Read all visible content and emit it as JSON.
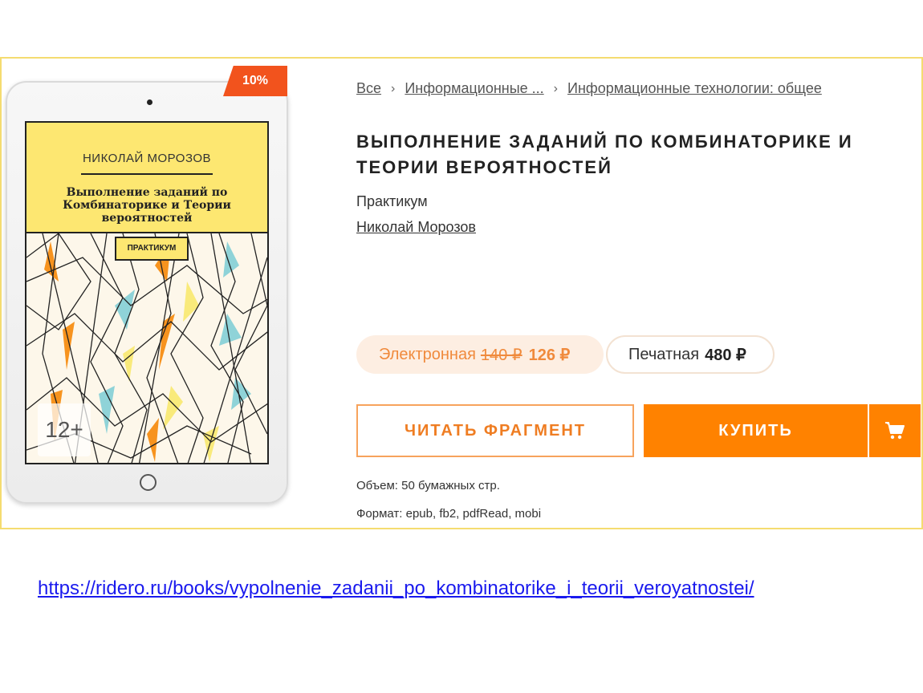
{
  "badge": {
    "discount": "10%"
  },
  "cover": {
    "author": "НИКОЛАЙ МОРОЗОВ",
    "title": "Выполнение заданий по Комбинаторике и Теории вероятностей",
    "label": "ПРАКТИКУМ",
    "age_rating": "12+",
    "colors": {
      "top": "#fde771",
      "orange": "#f7931e",
      "blue": "#8fd3d8",
      "yellow": "#f9ea7b"
    }
  },
  "breadcrumb": {
    "items": [
      "Все",
      "Информационные ...",
      "Информационные технологии: общее"
    ],
    "separator": "›"
  },
  "book": {
    "title": "ВЫПОЛНЕНИЕ ЗАДАНИЙ ПО КОМБИНАТОРИКЕ И ТЕОРИИ ВЕРОЯТНОСТЕЙ",
    "subtitle": "Практикум",
    "author": "Николай Морозов"
  },
  "prices": {
    "ebook": {
      "label": "Электронная",
      "old": "140 ₽",
      "new": "126 ₽"
    },
    "print": {
      "label": "Печатная",
      "price": "480 ₽"
    }
  },
  "actions": {
    "read_fragment": "ЧИТАТЬ ФРАГМЕНТ",
    "buy": "КУПИТЬ",
    "cart_icon": "cart-icon"
  },
  "details": {
    "volume": "Объем: 50 бумажных стр.",
    "format": "Формат: epub, fb2, pdfRead, mobi"
  },
  "source_url": "https://ridero.ru/books/vypolnenie_zadanii_po_kombinatorike_i_teorii_veroyatnostei/",
  "theme": {
    "accent": "#ff8200",
    "discount": "#f2531d",
    "frame": "#f5dc70"
  }
}
